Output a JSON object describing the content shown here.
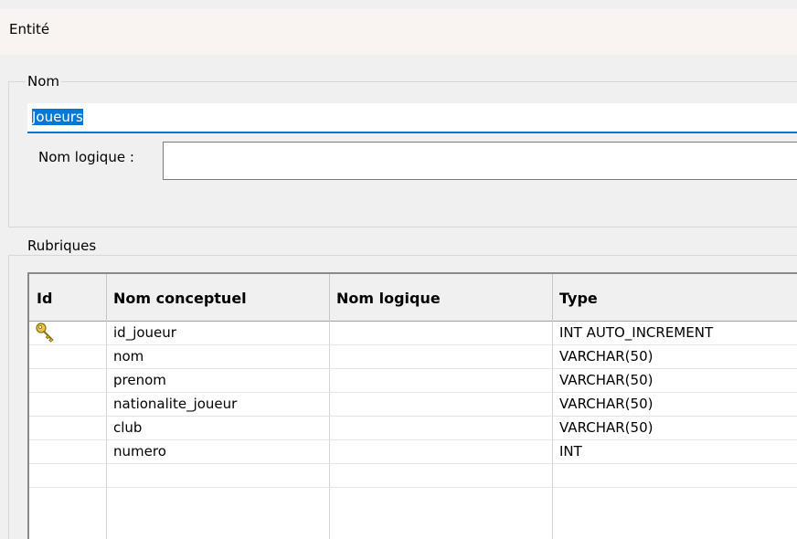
{
  "window": {
    "title": "Entité"
  },
  "nom_group": {
    "legend": "Nom",
    "name_value": "Joueurs",
    "logique_label": "Nom logique :",
    "logique_value": ""
  },
  "rubriques": {
    "legend": "Rubriques",
    "columns": [
      "Id",
      "Nom conceptuel",
      "Nom logique",
      "Type"
    ],
    "rows": [
      {
        "id_icon": "key-icon",
        "nom": "id_joueur",
        "logique": "",
        "type": "INT AUTO_INCREMENT"
      },
      {
        "id_icon": "",
        "nom": "nom",
        "logique": "",
        "type": "VARCHAR(50)"
      },
      {
        "id_icon": "",
        "nom": "prenom",
        "logique": "",
        "type": "VARCHAR(50)"
      },
      {
        "id_icon": "",
        "nom": "nationalite_joueur",
        "logique": "",
        "type": "VARCHAR(50)"
      },
      {
        "id_icon": "",
        "nom": "club",
        "logique": "",
        "type": "VARCHAR(50)"
      },
      {
        "id_icon": "",
        "nom": "numero",
        "logique": "",
        "type": "INT"
      },
      {
        "id_icon": "",
        "nom": "",
        "logique": "",
        "type": ""
      }
    ]
  },
  "colors": {
    "selection": "#0078d7",
    "key_icon": "#e8c54a"
  }
}
